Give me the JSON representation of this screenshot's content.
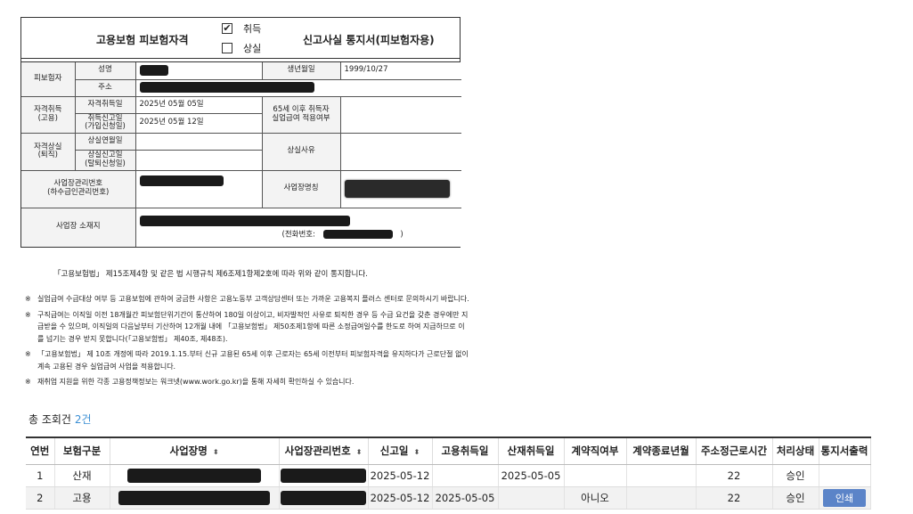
{
  "form": {
    "title_left": "고용보험 피보험자격",
    "title_right": "신고사실 통지서(피보험자용)",
    "check_acquire_mark": "✔",
    "check_acquire_label": "취득",
    "check_lose_label": "상실",
    "labels": {
      "insured": "피보험자",
      "name": "성명",
      "birth": "생년월일",
      "address": "주소",
      "acq_group": "자격취득\n(고용)",
      "acq_date": "자격취득일",
      "acq_report_date": "취득신고일\n(가입신청일)",
      "over65": "65세 이후 취득자\n실업급여 적용여부",
      "loss_group": "자격상실\n(퇴직)",
      "loss_date": "상실연월일",
      "loss_report_date": "상실신고일\n(탈퇴신청일)",
      "loss_reason": "상실사유",
      "biz_no": "사업장관리번호\n(하수급인관리번호)",
      "biz_name": "사업장명칭",
      "biz_addr": "사업장 소재지",
      "phone": "(전화번호:",
      "phone_close": ")"
    },
    "values": {
      "birth": "1999/10/27",
      "acq_date": "2025년 05월 05일",
      "acq_report_date": "2025년 05월 12일"
    }
  },
  "law_text": "「고용보험법」 제15조제4항 및 같은 법 시행규칙 제6조제1항제2호에 따라 위와 같이 통지합니다.",
  "notes": [
    {
      "mark": "※",
      "text": "실업급여 수급대상 여부 등 고용보험에 관하여 궁금한 사항은 고용노동부 고객상담센터 또는 가까운 고용복지 플러스 센터로 문의하시기 바랍니다."
    },
    {
      "mark": "※",
      "text": "구직급여는 이직일 이전 18개월간 피보험단위기간이 통산하여 180일 이상이고, 비자발적인 사유로 퇴직한 경우 등 수급 요건을 갖춘 경우에만 지급받을 수 있으며, 이직일의 다음날부터 기산하여 12개월 내에 「고용보험법」 제50조제1항에 따른 소정급여일수를 한도로 하여 지급하므로 이를 넘기는 경우 받지 못합니다(「고용보험법」 제40조, 제48조)."
    },
    {
      "mark": "※",
      "text": "「고용보험법」 제 10조 개정에 따라 2019.1.15.부터 신규 고용된 65세 이후 근로자는 65세 이전부터 피보험자격을 유지하다가 근로단절 없이 계속 고용된 경우 실업급여 사업을 적용합니다."
    },
    {
      "mark": "※",
      "text": "재취업 지원을 위한 각종 고용정책정보는 워크넷(www.work.go.kr)을 통해 자세히 확인하실 수 있습니다."
    }
  ],
  "count_label": "총 조회건",
  "count_value": "2건",
  "grid": {
    "sort_icon": "⬍",
    "columns": [
      {
        "label": "연번",
        "sortable": false
      },
      {
        "label": "보험구분",
        "sortable": false
      },
      {
        "label": "사업장명",
        "sortable": true
      },
      {
        "label": "사업장관리번호",
        "sortable": true
      },
      {
        "label": "신고일",
        "sortable": true
      },
      {
        "label": "고용취득일",
        "sortable": false
      },
      {
        "label": "산재취득일",
        "sortable": false
      },
      {
        "label": "계약직여부",
        "sortable": false
      },
      {
        "label": "계약종료년월",
        "sortable": false
      },
      {
        "label": "주소정근로시간",
        "sortable": false
      },
      {
        "label": "처리상태",
        "sortable": false
      },
      {
        "label": "통지서출력",
        "sortable": false
      }
    ],
    "rows": [
      {
        "no": "1",
        "type": "산재",
        "report_date": "2025-05-12",
        "emp_date": "",
        "ind_date": "2025-05-05",
        "contract": "",
        "contract_end": "",
        "hours": "22",
        "status": "승인",
        "print": ""
      },
      {
        "no": "2",
        "type": "고용",
        "report_date": "2025-05-12",
        "emp_date": "2025-05-05",
        "ind_date": "",
        "contract": "아니오",
        "contract_end": "",
        "hours": "22",
        "status": "승인",
        "print": "인쇄"
      }
    ]
  }
}
